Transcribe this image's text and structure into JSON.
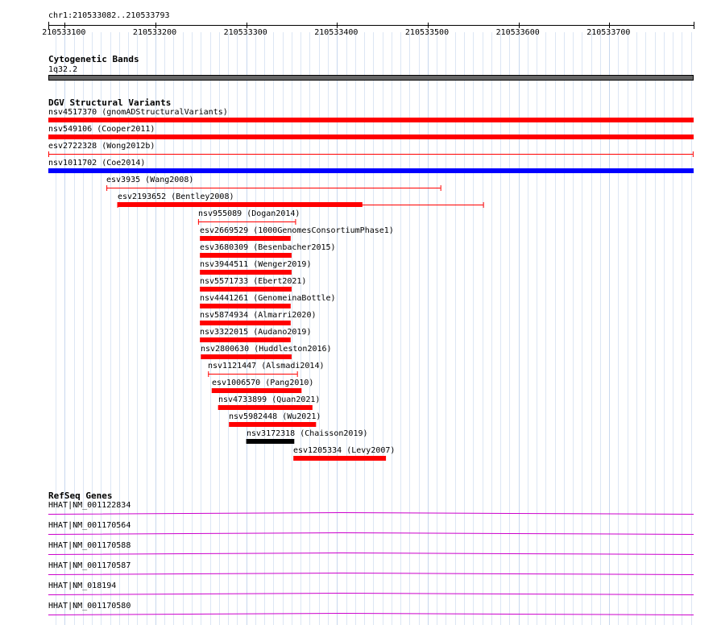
{
  "region": "chr1:210533082..210533793",
  "ruler": {
    "start": 210533082,
    "end": 210533793,
    "ticks": [
      "210533100",
      "210533200",
      "210533300",
      "210533400",
      "210533500",
      "210533600",
      "210533700"
    ]
  },
  "cytoband": {
    "title": "Cytogenetic Bands",
    "band": "1q32.2",
    "color": "#666666"
  },
  "dgv": {
    "title": "DGV Structural Variants",
    "variants": [
      {
        "label": "nsv4517370 (gnomADStructuralVariants)",
        "start": 210533082,
        "end": 210533793,
        "style": "bar",
        "color": "#ff0000"
      },
      {
        "label": "nsv549106 (Cooper2011)",
        "start": 210533082,
        "end": 210533793,
        "style": "bar",
        "color": "#ff0000"
      },
      {
        "label": "esv2722328 (Wong2012b)",
        "start": 210533082,
        "end": 210533792,
        "style": "line",
        "color": "#ff0000"
      },
      {
        "label": "nsv1011702 (Coe2014)",
        "start": 210533082,
        "end": 210533793,
        "style": "bar",
        "color": "#0000ff"
      },
      {
        "label": "esv3935 (Wang2008)",
        "start": 210533146,
        "end": 210533514,
        "style": "line",
        "color": "#ff0000"
      },
      {
        "label": "esv2193652 (Bentley2008)",
        "start": 210533158,
        "end": 210533561,
        "style": "linebar",
        "thick_start": 210533158,
        "thick_end": 210533428,
        "color": "#ff0000"
      },
      {
        "label": "nsv955089 (Dogan2014)",
        "start": 210533247,
        "end": 210533354,
        "style": "line",
        "color": "#ff0000"
      },
      {
        "label": "esv2669529 (1000GenomesConsortiumPhase1)",
        "start": 210533249,
        "end": 210533349,
        "style": "bar",
        "color": "#ff0000"
      },
      {
        "label": "esv3680309 (Besenbacher2015)",
        "start": 210533249,
        "end": 210533350,
        "style": "bar",
        "color": "#ff0000"
      },
      {
        "label": "nsv3944511 (Wenger2019)",
        "start": 210533249,
        "end": 210533350,
        "style": "bar",
        "color": "#ff0000"
      },
      {
        "label": "nsv5571733 (Ebert2021)",
        "start": 210533249,
        "end": 210533350,
        "style": "bar",
        "color": "#ff0000"
      },
      {
        "label": "nsv4441261 (GenomeinaBottle)",
        "start": 210533249,
        "end": 210533349,
        "style": "bar",
        "color": "#ff0000"
      },
      {
        "label": "nsv5874934 (Almarri2020)",
        "start": 210533249,
        "end": 210533349,
        "style": "bar",
        "color": "#ff0000"
      },
      {
        "label": "nsv3322015 (Audano2019)",
        "start": 210533249,
        "end": 210533349,
        "style": "bar",
        "color": "#ff0000"
      },
      {
        "label": "nsv2800630 (Huddleston2016)",
        "start": 210533250,
        "end": 210533350,
        "style": "bar",
        "color": "#ff0000"
      },
      {
        "label": "nsv1121447 (Alsmadi2014)",
        "start": 210533258,
        "end": 210533356,
        "style": "line",
        "color": "#ff0000"
      },
      {
        "label": "esv1006570 (Pang2010)",
        "start": 210533262,
        "end": 210533361,
        "style": "bar",
        "color": "#ff0000"
      },
      {
        "label": "nsv4733899 (Quan2021)",
        "start": 210533269,
        "end": 210533373,
        "style": "bar",
        "color": "#ff0000"
      },
      {
        "label": "nsv5982448 (Wu2021)",
        "start": 210533281,
        "end": 210533377,
        "style": "bar",
        "color": "#ff0000"
      },
      {
        "label": "nsv3172318 (Chaisson2019)",
        "start": 210533300,
        "end": 210533353,
        "style": "bar",
        "color": "#000000"
      },
      {
        "label": "esv1205334 (Levy2007)",
        "start": 210533352,
        "end": 210533454,
        "style": "bar",
        "color": "#ff0000"
      }
    ]
  },
  "refseq": {
    "title": "RefSeq Genes",
    "color": "#cc00cc",
    "genes": [
      "HHAT|NM_001122834",
      "HHAT|NM_001170564",
      "HHAT|NM_001170588",
      "HHAT|NM_001170587",
      "HHAT|NM_018194",
      "HHAT|NM_001170580"
    ]
  }
}
